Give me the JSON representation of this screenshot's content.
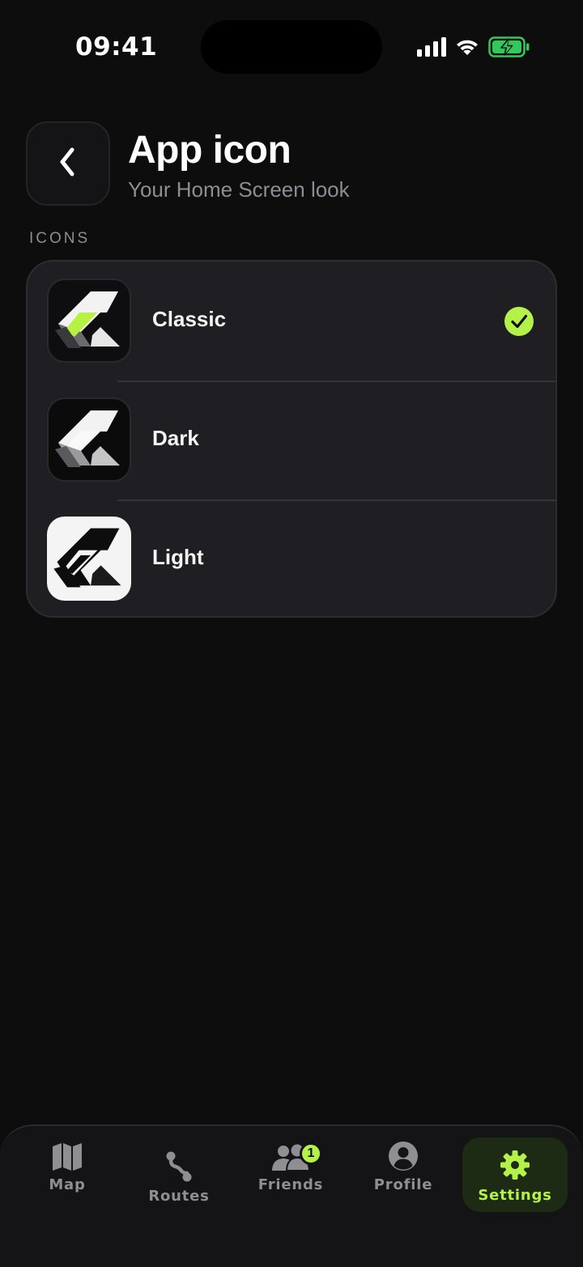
{
  "status_bar": {
    "time": "09:41",
    "icons": [
      "signal-icon",
      "wifi-icon",
      "battery-charging-icon"
    ],
    "battery_color": "#34c759"
  },
  "header": {
    "back_icon": "chevron-left-icon",
    "title": "App icon",
    "subtitle": "Your Home Screen look"
  },
  "section": {
    "label": "ICONS"
  },
  "icon_options": [
    {
      "label": "Classic",
      "icon": "classic-app-icon",
      "selected": true
    },
    {
      "label": "Dark",
      "icon": "dark-app-icon",
      "selected": false
    },
    {
      "label": "Light",
      "icon": "light-app-icon",
      "selected": false
    }
  ],
  "tab_bar": {
    "tabs": [
      {
        "label": "Map",
        "icon": "map-icon",
        "active": false
      },
      {
        "label": "Routes",
        "icon": "route-icon",
        "active": false
      },
      {
        "label": "Friends",
        "icon": "friends-icon",
        "active": false,
        "badge": "1"
      },
      {
        "label": "Profile",
        "icon": "profile-icon",
        "active": false
      },
      {
        "label": "Settings",
        "icon": "gear-icon",
        "active": true
      }
    ]
  },
  "colors": {
    "accent": "#b4f24a",
    "background": "#0d0d0e",
    "card": "#1f1f23",
    "secondary_text": "#8d8d93"
  }
}
